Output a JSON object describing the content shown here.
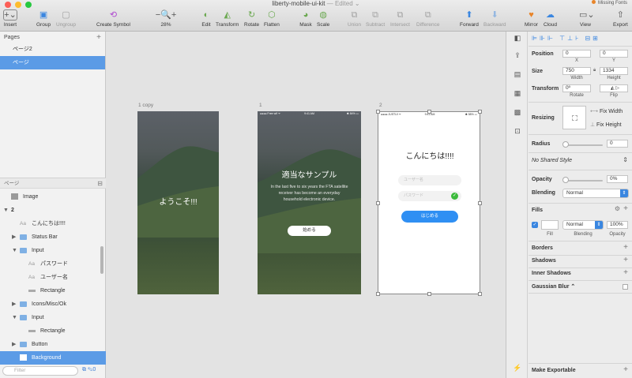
{
  "window": {
    "title": "liberty-mobile-ui-kit",
    "edited": "— Edited ⌄",
    "missing_fonts": "Missing Fonts"
  },
  "toolbar": {
    "insert": "Insert",
    "group": "Group",
    "ungroup": "Ungroup",
    "create_symbol": "Create Symbol",
    "zoom": "28%",
    "edit": "Edit",
    "transform": "Transform",
    "rotate": "Rotate",
    "flatten": "Flatten",
    "mask": "Mask",
    "scale": "Scale",
    "union": "Union",
    "subtract": "Subtract",
    "intersect": "Intersect",
    "difference": "Difference",
    "forward": "Forward",
    "backward": "Backward",
    "mirror": "Mirror",
    "cloud": "Cloud",
    "view": "View",
    "export": "Export"
  },
  "pages": {
    "header": "Pages",
    "items": [
      "ページ2",
      "ページ"
    ],
    "selected": 1
  },
  "layers": {
    "header": "ページ",
    "items": [
      {
        "label": "Image",
        "kind": "image",
        "indent": 0,
        "arrow": ""
      },
      {
        "label": "2",
        "kind": "artboard",
        "indent": 0,
        "arrow": "▼"
      },
      {
        "label": "こんにちは!!!!",
        "kind": "text",
        "indent": 1,
        "arrow": ""
      },
      {
        "label": "Status Bar",
        "kind": "folder",
        "indent": 1,
        "arrow": "▶"
      },
      {
        "label": "Input",
        "kind": "folder",
        "indent": 1,
        "arrow": "▼"
      },
      {
        "label": "パスワード",
        "kind": "text",
        "indent": 2,
        "arrow": ""
      },
      {
        "label": "ユーザー名",
        "kind": "text",
        "indent": 2,
        "arrow": ""
      },
      {
        "label": "Rectangle",
        "kind": "rect",
        "indent": 2,
        "arrow": ""
      },
      {
        "label": "Icons/Misc/Ok",
        "kind": "folder",
        "indent": 1,
        "arrow": "▶"
      },
      {
        "label": "Input",
        "kind": "folder",
        "indent": 1,
        "arrow": "▼"
      },
      {
        "label": "Rectangle",
        "kind": "rect",
        "indent": 2,
        "arrow": ""
      },
      {
        "label": "Button",
        "kind": "folder",
        "indent": 1,
        "arrow": "▶"
      },
      {
        "label": "Background",
        "kind": "image",
        "indent": 1,
        "arrow": "",
        "selected": true
      }
    ],
    "filter_placeholder": "Filter"
  },
  "artboards": {
    "a1": {
      "label": "1 copy",
      "welcome": "ようこそ!!!"
    },
    "a2": {
      "label": "1",
      "status_left": "●●●● Free wif ᯤ",
      "status_time": "9:41 AM",
      "status_right": "✱ 84% ▭",
      "title": "適当なサンプル",
      "body": "In the last five to six years the FTA satellite receiver has become an everyday household electronic device.",
      "button": "始める"
    },
    "a3": {
      "label": "2",
      "status_left": "●●●● JUSTUI ᯤ",
      "status_time": "9:41 AM",
      "status_right": "✱ 58% ▭",
      "title": "こんにちは!!!!",
      "username_placeholder": "ユーザー名",
      "password_placeholder": "パスワード",
      "button": "はじめる"
    }
  },
  "inspector": {
    "position_label": "Position",
    "x": "0",
    "y": "0",
    "x_label": "X",
    "y_label": "Y",
    "size_label": "Size",
    "width": "750",
    "height": "1334",
    "width_label": "Width",
    "height_label": "Height",
    "transform_label": "Transform",
    "rotate": "0º",
    "rotate_label": "Rotate",
    "flip_label": "Flip",
    "resizing_label": "Resizing",
    "fix_width": "Fix Width",
    "fix_height": "Fix Height",
    "radius_label": "Radius",
    "radius": "0",
    "shared_style": "No Shared Style",
    "opacity_label": "Opacity",
    "opacity": "0%",
    "blending_label": "Blending",
    "blending": "Normal",
    "fills_label": "Fills",
    "fill_blend": "Normal",
    "fill_opacity": "100%",
    "fill_sub": "Fill",
    "blending_sub": "Blending",
    "opacity_sub": "Opacity",
    "borders": "Borders",
    "shadows": "Shadows",
    "inner_shadows": "Inner Shadows",
    "gaussian_blur": "Gaussian Blur ⌃",
    "make_exportable": "Make Exportable"
  },
  "colors": {
    "accent": "#5b9be6",
    "button_blue": "#2f8ff3",
    "ok_green": "#3cba3c"
  }
}
